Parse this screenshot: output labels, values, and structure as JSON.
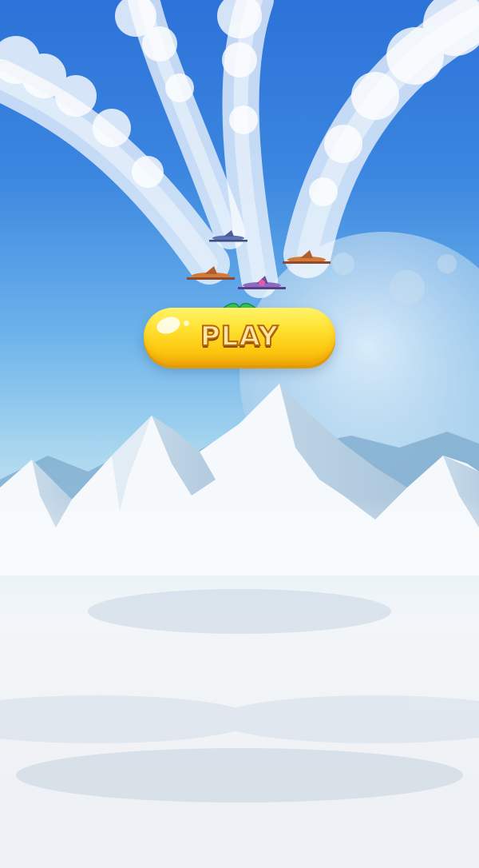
{
  "menu": {
    "play_label": "PLAY"
  },
  "colors": {
    "sky_top": "#2c72d8",
    "sky_mid": "#4e9ee6",
    "sky_low": "#a8d6ef",
    "button_yellow": "#ffe233",
    "button_outline": "#b8650c",
    "leaf_green": "#34c25a"
  },
  "icons": {
    "airplanes": [
      "airplane-icon",
      "airplane-icon",
      "airplane-icon",
      "airplane-icon"
    ],
    "play_decoration": "leaf-icon"
  }
}
